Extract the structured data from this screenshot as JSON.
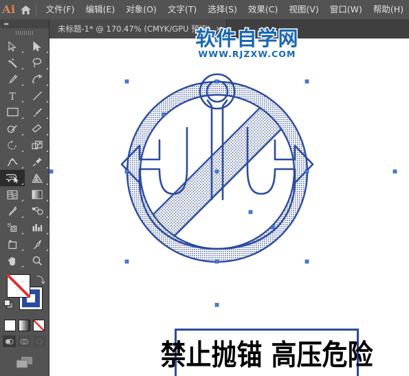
{
  "app": {
    "name": "Ai",
    "logo_color": "#d9865a",
    "chrome_bg": "#535353",
    "accent_blue": "#2b4ba0"
  },
  "menubar": {
    "home_icon": "home-icon",
    "items": [
      {
        "label": "文件(F)",
        "name": "menu-file"
      },
      {
        "label": "编辑(E)",
        "name": "menu-edit"
      },
      {
        "label": "对象(O)",
        "name": "menu-object"
      },
      {
        "label": "文字(T)",
        "name": "menu-type"
      },
      {
        "label": "选择(S)",
        "name": "menu-select"
      },
      {
        "label": "效果(C)",
        "name": "menu-effect"
      },
      {
        "label": "视图(V)",
        "name": "menu-view"
      },
      {
        "label": "窗口(W)",
        "name": "menu-window"
      },
      {
        "label": "帮助(H)",
        "name": "menu-help"
      }
    ]
  },
  "tabbar": {
    "document_title": "未标题-1* @ 170.47% (CMYK/GPU 预览)",
    "close_label": "✕"
  },
  "toolbar": {
    "collapse_label": "◂◂",
    "tools": [
      {
        "name": "selection-tool",
        "icon": "selection-arrow-icon",
        "selected": false
      },
      {
        "name": "direct-selection-tool",
        "icon": "direct-selection-arrow-icon",
        "selected": false
      },
      {
        "name": "magic-wand-tool",
        "icon": "magic-wand-icon",
        "selected": false
      },
      {
        "name": "lasso-tool",
        "icon": "lasso-icon",
        "selected": false
      },
      {
        "name": "pen-tool",
        "icon": "pen-icon",
        "selected": false
      },
      {
        "name": "curvature-tool",
        "icon": "curvature-icon",
        "selected": false
      },
      {
        "name": "type-tool",
        "icon": "type-t-icon",
        "selected": false
      },
      {
        "name": "line-segment-tool",
        "icon": "line-icon",
        "selected": false
      },
      {
        "name": "rectangle-tool",
        "icon": "rectangle-icon",
        "selected": false
      },
      {
        "name": "paintbrush-tool",
        "icon": "paintbrush-icon",
        "selected": false
      },
      {
        "name": "shaper-tool",
        "icon": "shaper-pencil-icon",
        "selected": false
      },
      {
        "name": "eraser-tool",
        "icon": "eraser-icon",
        "selected": false
      },
      {
        "name": "rotate-tool",
        "icon": "rotate-icon",
        "selected": false
      },
      {
        "name": "scale-tool",
        "icon": "scale-icon",
        "selected": false
      },
      {
        "name": "width-tool",
        "icon": "width-warp-icon",
        "selected": false
      },
      {
        "name": "free-transform-tool",
        "icon": "pushpin-icon",
        "selected": false
      },
      {
        "name": "shape-builder-tool",
        "icon": "shape-builder-icon",
        "selected": true
      },
      {
        "name": "perspective-grid-tool",
        "icon": "perspective-grid-icon",
        "selected": false
      },
      {
        "name": "mesh-tool",
        "icon": "mesh-icon",
        "selected": false
      },
      {
        "name": "gradient-tool",
        "icon": "gradient-icon",
        "selected": false
      },
      {
        "name": "eyedropper-tool",
        "icon": "eyedropper-icon",
        "selected": false
      },
      {
        "name": "blend-tool",
        "icon": "blend-icon",
        "selected": false
      },
      {
        "name": "symbol-sprayer-tool",
        "icon": "symbol-sprayer-icon",
        "selected": false
      },
      {
        "name": "column-graph-tool",
        "icon": "bar-chart-icon",
        "selected": false
      },
      {
        "name": "artboard-tool",
        "icon": "artboard-icon",
        "selected": false
      },
      {
        "name": "slice-tool",
        "icon": "slice-knife-icon",
        "selected": false
      },
      {
        "name": "hand-tool",
        "icon": "hand-icon",
        "selected": false
      },
      {
        "name": "zoom-tool",
        "icon": "magnifier-icon",
        "selected": false
      }
    ],
    "swatches": {
      "fill": "none",
      "fill_color": "#ffffff",
      "stroke_color": "#2b4ba0",
      "swap_icon": "swap-arrow-icon",
      "default_icon": "default-swatch-icon"
    },
    "fill_modes": [
      {
        "name": "color-mode-button",
        "label": "solid"
      },
      {
        "name": "gradient-mode-button",
        "label": "gradient"
      },
      {
        "name": "none-mode-button",
        "label": "none"
      }
    ],
    "draw_modes": [
      {
        "name": "draw-normal-button",
        "active": true
      },
      {
        "name": "draw-behind-button",
        "active": false
      },
      {
        "name": "draw-inside-button",
        "active": false
      }
    ],
    "screen_mode": {
      "name": "change-screen-mode-button",
      "icon": "screen-mode-icon"
    }
  },
  "canvas": {
    "watermark": {
      "main": "软件自学网",
      "sub": "WWW.RJZXW.COM",
      "color": "#1767b2"
    },
    "artwork": {
      "name": "no-anchoring-sign",
      "symbol_description": "prohibition-circle-with-anchor",
      "stroke_color": "#2b4ba0",
      "fill_pattern": "halftone-dots",
      "sign_text": "禁止抛锚 高压危险",
      "sign_text_color": "#000000",
      "sign_box_border_color": "#2b4ba0"
    },
    "selection": {
      "visible": true,
      "handle_color": "#4a7de0"
    }
  }
}
